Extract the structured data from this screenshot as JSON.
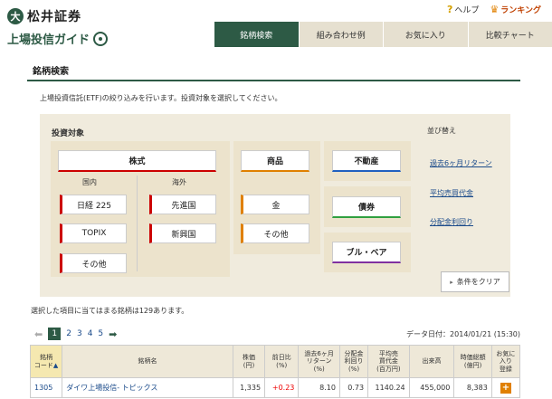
{
  "brand": {
    "name": "松井証券",
    "logo_glyph": "大",
    "subtitle": "上場投信ガイド"
  },
  "top_links": {
    "help": "ヘルプ",
    "ranking": "ランキング"
  },
  "nav": {
    "tabs": [
      {
        "label": "銘柄検索",
        "active": true
      },
      {
        "label": "組み合わせ例",
        "active": false
      },
      {
        "label": "お気に入り",
        "active": false
      },
      {
        "label": "比較チャート",
        "active": false
      }
    ]
  },
  "page": {
    "title": "銘柄検索",
    "description": "上場投資信託(ETF)の絞り込みを行います。投資対象を選択してください。"
  },
  "filter": {
    "title": "投資対象",
    "stocks": "株式",
    "domestic_label": "国内",
    "overseas_label": "海外",
    "domestic": [
      "日経 225",
      "TOPIX",
      "その他"
    ],
    "overseas": [
      "先進国",
      "新興国"
    ],
    "commodity": "商品",
    "commodity_items": [
      "金",
      "その他"
    ],
    "real_estate": "不動産",
    "bonds": "債券",
    "bull_bear": "ブル・ベア"
  },
  "sort": {
    "title": "並び替え",
    "options": [
      "過去6ヶ月リターン",
      "平均売買代金",
      "分配金利回り"
    ]
  },
  "clear_button": "条件をクリア",
  "result_text": "選択した項目に当てはまる銘柄は129あります。",
  "pager": {
    "pages": [
      "1",
      "2",
      "3",
      "4",
      "5"
    ],
    "current": "1"
  },
  "data_date": "データ日付：2014/01/21 (15:30)",
  "table": {
    "headers": {
      "code": "銘柄\nコード",
      "name": "銘柄名",
      "price": "株価\n(円)",
      "change": "前日比\n(%)",
      "return6m": "過去6ヶ月\nリターン\n(%)",
      "yield": "分配金\n利回り\n(%)",
      "avg_volume": "平均売\n買代金\n(百万円)",
      "volume": "出来高",
      "market_cap": "時価総額\n(億円)",
      "favorite": "お気に\n入り\n登録"
    },
    "rows": [
      {
        "code": "1305",
        "name": "ダイワ上場投信- トピックス",
        "price": "1,335",
        "change": "+0.23",
        "return6m": "8.10",
        "yield": "0.73",
        "avg_volume": "1140.24",
        "volume": "455,000",
        "market_cap": "8,383"
      }
    ]
  },
  "colors": {
    "brand_green": "#2d5a45",
    "accent_red": "#cc0000",
    "accent_orange": "#e08000",
    "panel_bg": "#f0ebdd"
  }
}
